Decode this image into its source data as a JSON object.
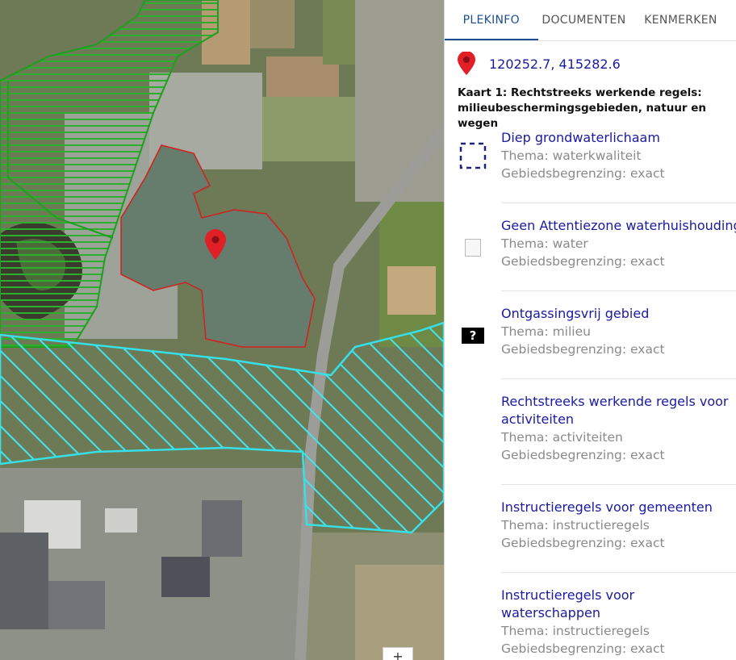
{
  "map": {
    "marker_icon": "map-pin-icon",
    "zoom_in_label": "+"
  },
  "tabs": [
    {
      "label": "PLEKINFO",
      "active": true
    },
    {
      "label": "DOCUMENTEN",
      "active": false
    },
    {
      "label": "KENMERKEN",
      "active": false
    }
  ],
  "location": {
    "icon": "map-pin-icon",
    "coordinates": "120252.7, 415282.6"
  },
  "kaart_title": "Kaart 1: Rechtstreeks werkende regels: milieubeschermingsgebieden, natuur en wegen",
  "items": [
    {
      "icon": "dashed-square-icon",
      "title": "Diep grondwaterlichaam",
      "thema": "Thema: waterkwaliteit",
      "begrenzing": "Gebiedsbegrenzing: exact"
    },
    {
      "icon": "image-placeholder-icon",
      "title": "Geen Attentiezone waterhuishouding",
      "thema": "Thema: water",
      "begrenzing": "Gebiedsbegrenzing: exact"
    },
    {
      "icon": "question-mark-icon",
      "icon_text": "?",
      "title": "Ontgassingsvrij gebied",
      "thema": "Thema: milieu",
      "begrenzing": "Gebiedsbegrenzing: exact"
    },
    {
      "icon": "none",
      "title": "Rechtstreeks werkende regels voor activiteiten",
      "thema": "Thema: activiteiten",
      "begrenzing": "Gebiedsbegrenzing: exact"
    },
    {
      "icon": "none",
      "title": "Instructieregels voor gemeenten",
      "thema": "Thema: instructieregels",
      "begrenzing": "Gebiedsbegrenzing: exact"
    },
    {
      "icon": "none",
      "title": "Instructieregels voor waterschappen",
      "thema": "Thema: instructieregels",
      "begrenzing": "Gebiedsbegrenzing: exact"
    }
  ],
  "colors": {
    "link": "#1a1aa0",
    "muted": "#8a8a8a",
    "tab_active": "#1b4f8f",
    "cyan_zone": "#35e0e8",
    "green_zone": "#1f9e1f",
    "red_outline": "#d21f1f"
  }
}
